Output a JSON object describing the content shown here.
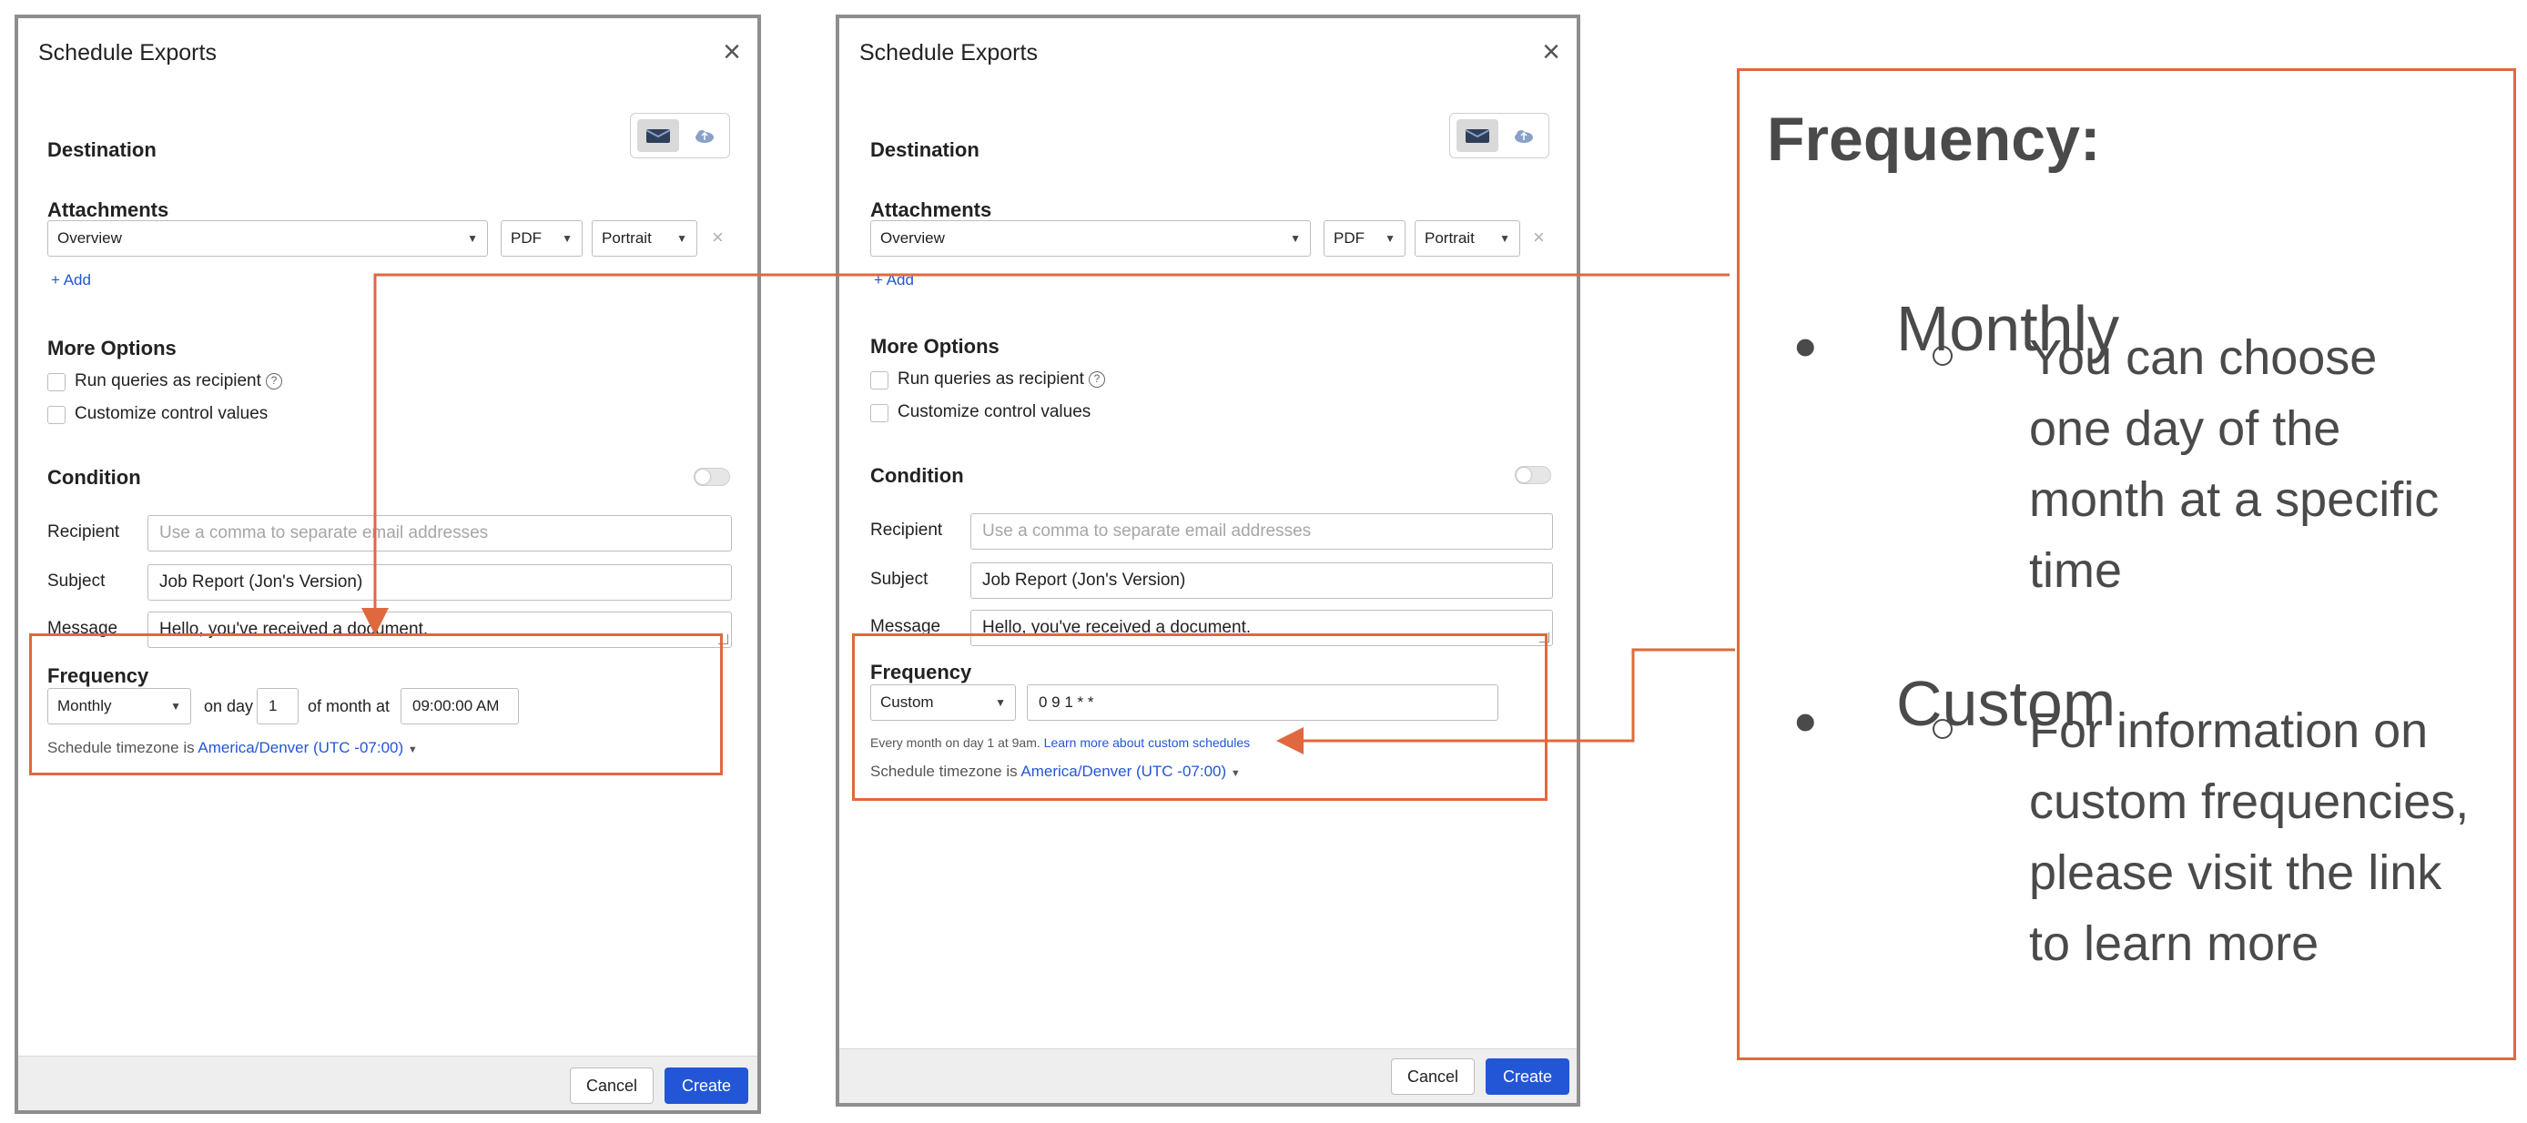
{
  "dialog": {
    "title": "Schedule Exports",
    "sections": {
      "destination": "Destination",
      "attachments": "Attachments",
      "more_options": "More Options",
      "condition": "Condition",
      "frequency": "Frequency"
    },
    "attachment": {
      "dashboard": "Overview",
      "format": "PDF",
      "orientation": "Portrait"
    },
    "add_label": "+ Add",
    "options": {
      "run_queries": "Run queries as recipient",
      "customize": "Customize control values"
    },
    "fields": {
      "recipient_label": "Recipient",
      "recipient_placeholder": "Use a comma to separate email addresses",
      "subject_label": "Subject",
      "subject_value": "Job Report (Jon's Version)",
      "message_label": "Message",
      "message_value": "Hello, you've received a document."
    },
    "timezone_prefix": "Schedule timezone is",
    "timezone_value": "America/Denver (UTC -07:00)",
    "cancel": "Cancel",
    "create": "Create"
  },
  "monthly": {
    "frequency": "Monthly",
    "on_day_label": "on day",
    "day_value": "1",
    "of_month_label": "of month at",
    "time_value": "09:00:00 AM"
  },
  "custom": {
    "frequency": "Custom",
    "cron_value": "0 9 1 * *",
    "description": "Every month on day 1 at 9am.",
    "learn_more": "Learn more about custom schedules"
  },
  "callout": {
    "title": "Frequency:",
    "items": [
      {
        "heading": "Monthly",
        "detail_lines": [
          "You can choose",
          "one day of the",
          "month at a specific",
          "time"
        ]
      },
      {
        "heading": "Custom",
        "detail_lines": [
          "For information on",
          "custom frequencies,",
          "please visit the link",
          "to learn more"
        ]
      }
    ]
  },
  "colors": {
    "accent": "#2356d6",
    "annotation": "#e0683e",
    "callout_text": "#4a4a4a"
  }
}
